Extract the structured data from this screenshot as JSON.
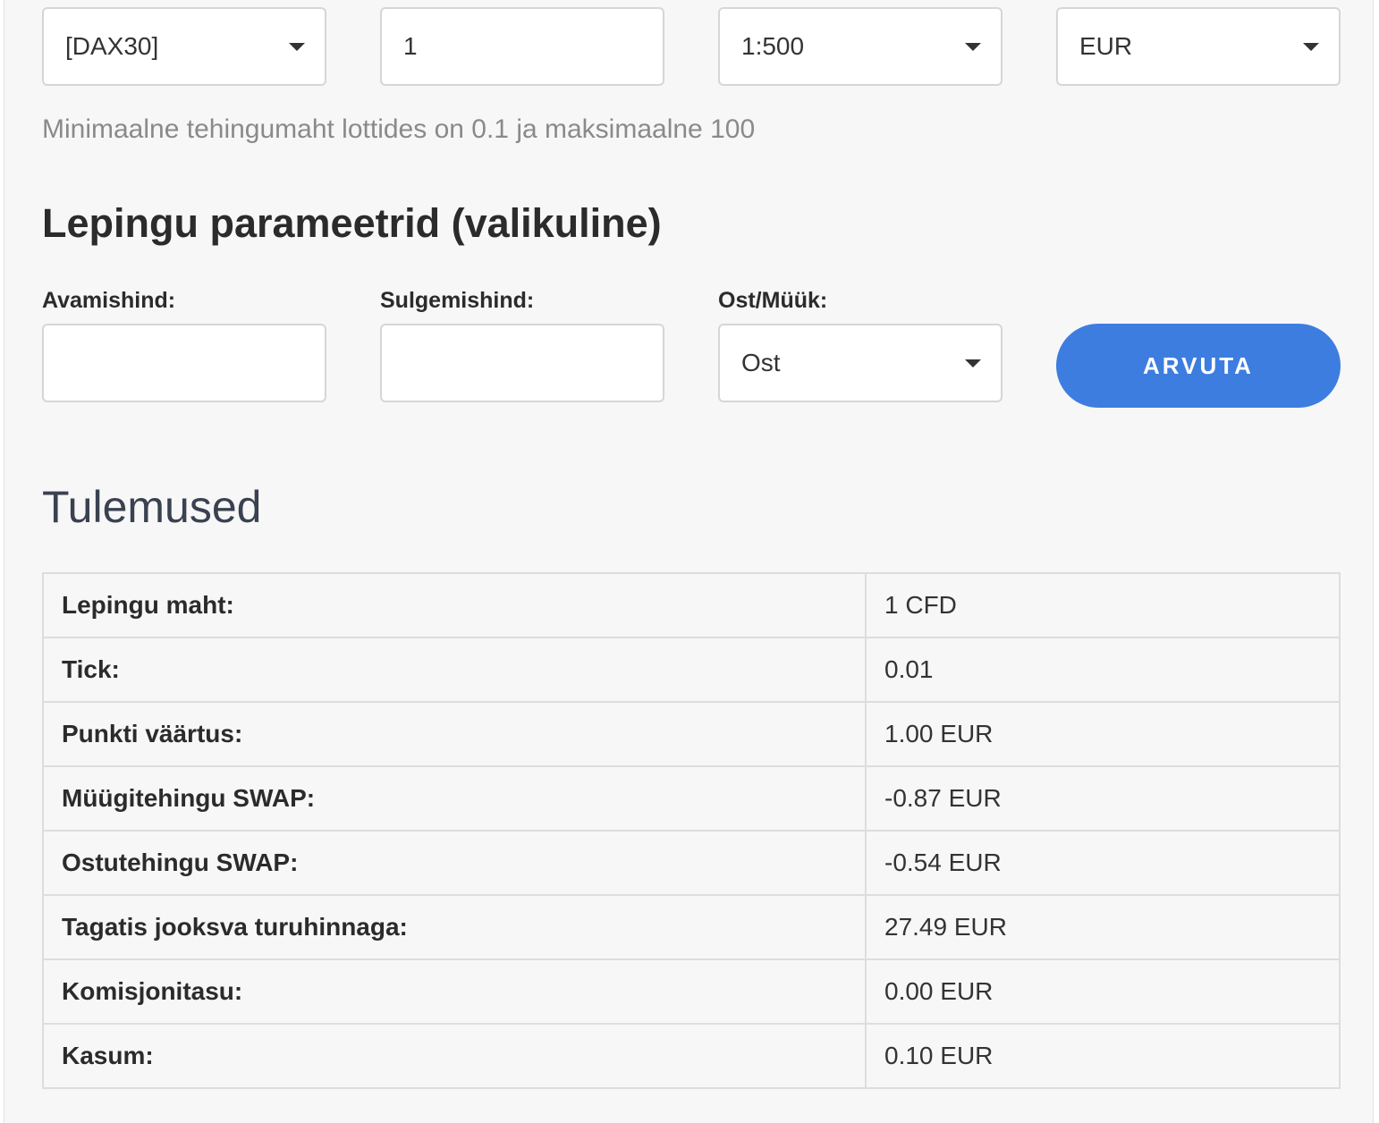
{
  "selectors": {
    "instrument": "[DAX30]",
    "volume": "1",
    "leverage": "1:500",
    "currency": "EUR"
  },
  "hint": "Minimaalne tehingumaht lottides on 0.1 ja maksimaalne 100",
  "contract_section": {
    "title": "Lepingu parameetrid (valikuline)",
    "open_price_label": "Avamishind:",
    "open_price_value": "",
    "close_price_label": "Sulgemishind:",
    "close_price_value": "",
    "direction_label": "Ost/Müük:",
    "direction_value": "Ost",
    "calculate_label": "ARVUTA"
  },
  "results": {
    "title": "Tulemused",
    "rows": [
      {
        "label": "Lepingu maht:",
        "value": "1 CFD"
      },
      {
        "label": "Tick:",
        "value": "0.01"
      },
      {
        "label": "Punkti väärtus:",
        "value": "1.00 EUR"
      },
      {
        "label": "Müügitehingu SWAP:",
        "value": "-0.87 EUR"
      },
      {
        "label": "Ostutehingu SWAP:",
        "value": "-0.54 EUR"
      },
      {
        "label": "Tagatis jooksva turuhinnaga:",
        "value": "27.49 EUR"
      },
      {
        "label": "Komisjonitasu:",
        "value": "0.00 EUR"
      },
      {
        "label": "Kasum:",
        "value": "0.10 EUR"
      }
    ]
  }
}
